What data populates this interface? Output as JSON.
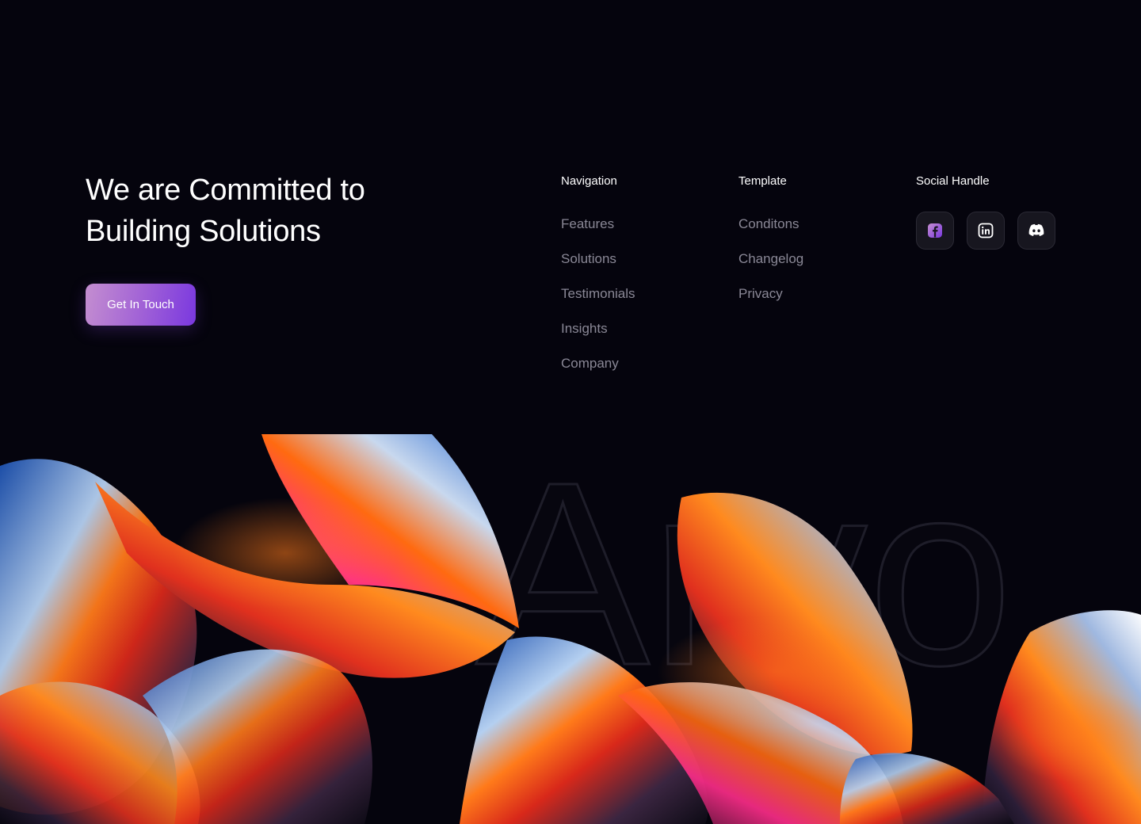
{
  "hero": {
    "headline": "We are Committed to Building Solutions",
    "cta_label": "Get In Touch"
  },
  "navigation": {
    "title": "Navigation",
    "links": [
      "Features",
      "Solutions",
      "Testimonials",
      "Insights",
      "Company"
    ]
  },
  "template": {
    "title": "Template",
    "links": [
      "Conditons",
      "Changelog",
      "Privacy"
    ]
  },
  "social": {
    "title": "Social Handle",
    "icons": [
      "facebook-icon",
      "linkedin-icon",
      "discord-icon"
    ]
  },
  "brand": {
    "wordmark": "Arvo"
  },
  "colors": {
    "background": "#05040d",
    "cta_start": "#c48ed0",
    "cta_end": "#7a38df",
    "link_muted": "#8a8896"
  }
}
